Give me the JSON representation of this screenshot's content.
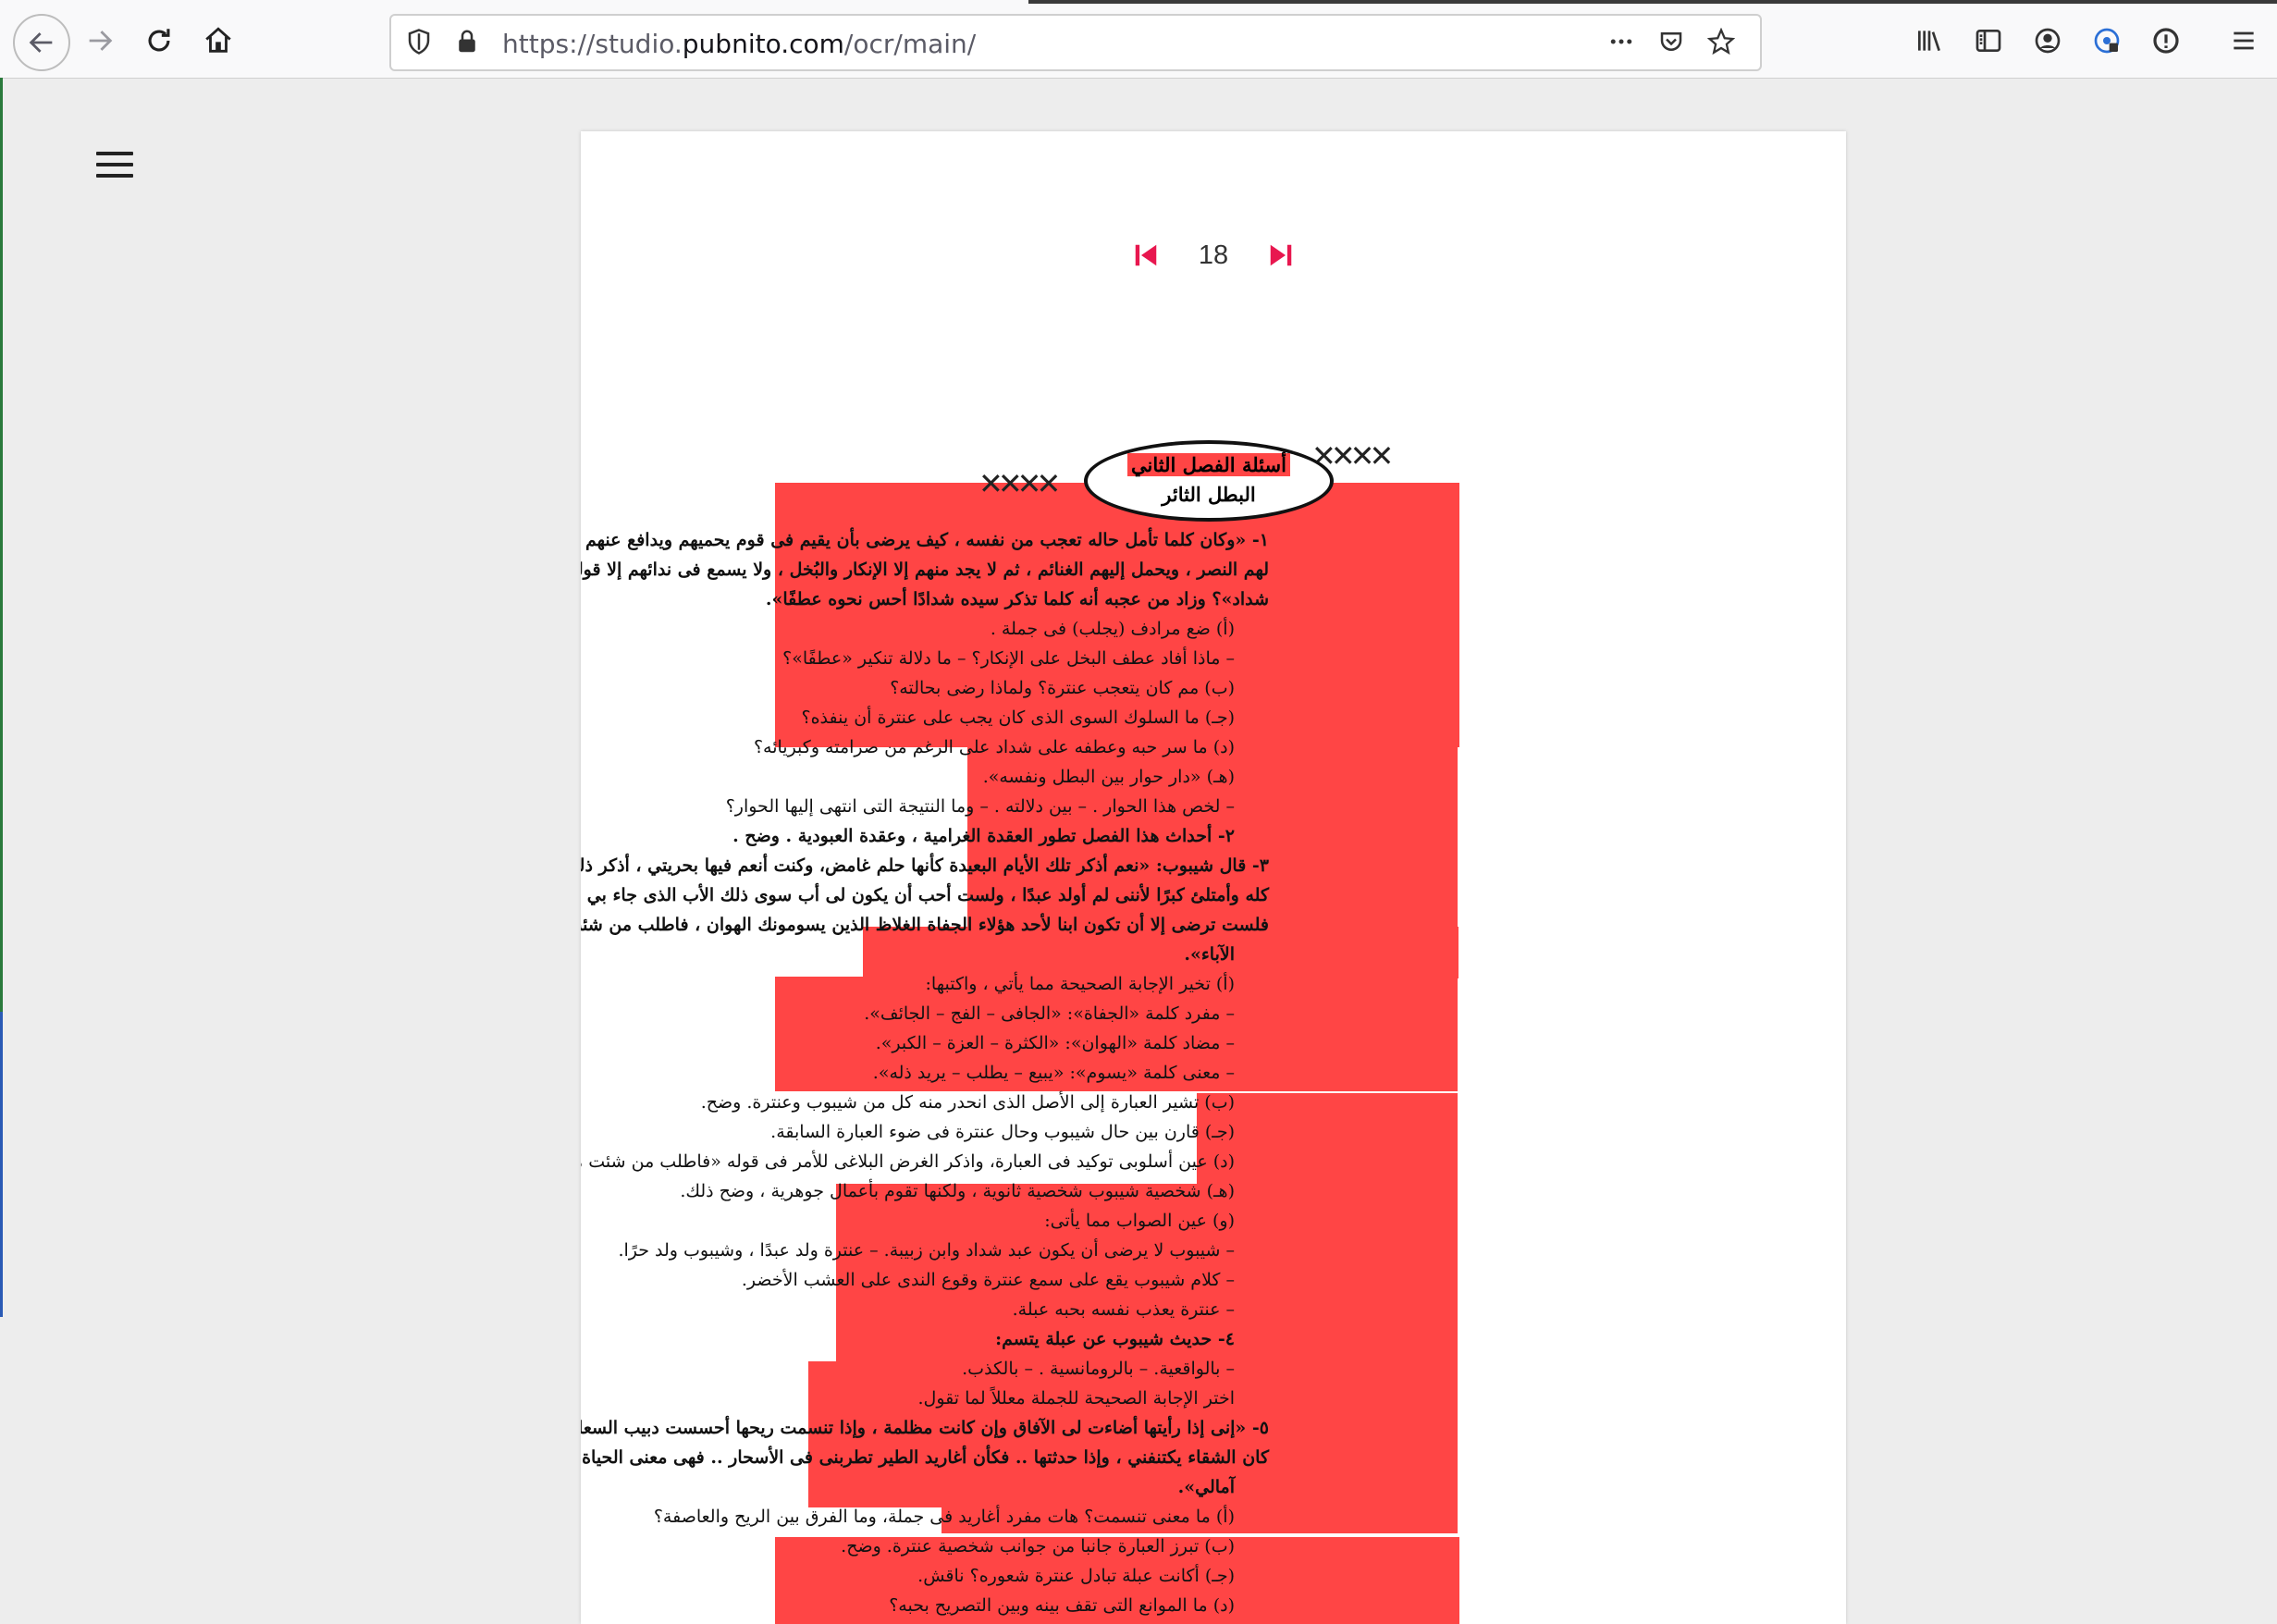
{
  "browser": {
    "url_prefix": "https://studio.",
    "url_domain": "pubnito.com",
    "url_path": "/ocr/main/",
    "icons": [
      "back-icon",
      "forward-icon",
      "reload-icon",
      "home-icon",
      "shield-icon",
      "lock-icon",
      "more-icon",
      "pocket-icon",
      "star-icon",
      "library-icon",
      "sidebar-icon",
      "account-icon",
      "extension-icon",
      "info-icon",
      "menu-icon"
    ]
  },
  "viewer": {
    "page_number": "18",
    "accent_color": "#e8174f",
    "highlight_color": "#ff4545"
  },
  "document": {
    "title_line1": "أسئلة الفصل الثاني",
    "title_line2": "البطل الثائر",
    "lines": [
      "١- «وكان كلما تأمل حاله تعجب من نفسه ، كيف يرضى بأن يقيم فى قوم يحميهم ويدافع عنهم ، ويجلب",
      "لهم النصر ، ويحمل إليهم الغنائم ، ثم لا يجد منهم إلا الإنكار والبُخل ، ولا يسمع فى ندائهم إلا قولهم «عبد",
      "شداد»؟ وزاد من عجبه أنه كلما تذكر سيده شدادًا أحس نحوه عطفًا».",
      "(أ) ضع مرادف (يجلب) فى جملة .",
      "– ماذا أفاد عطف البخل على الإنكار؟ – ما دلالة تنكير «عطفًا»؟",
      "(ب) مم كان يتعجب عنترة؟ ولماذا رضى بحالته؟",
      "(جـ) ما السلوك السوى الذى كان يجب على عنترة أن ينفذه؟",
      "(د) ما سر حبه وعطفه على شداد على الرغم من صرامته وكبريائه؟",
      "(هـ) «دار حوار بين البطل ونفسه».",
      "– لخص هذا الحوار . – بين دلالته . – وما النتيجة التى انتهى إليها الحوار؟",
      "٢- أحداث هذا الفصل تطور العقدة الغرامية ، وعقدة العبودية . وضح .",
      "٣- قال شيبوب: «نعم أذكر تلك الأيام البعيدة كأنها حلم غامض، وكنت أنعم فيها بحريتي ، أذكر ذلك",
      "كله وأمتلئ كبرًا لأننى لم أولد عبدًا ، ولست أحب أن يكون لى أب سوى ذلك الأب الذى جاء بي ، وأما انت",
      "فلست ترضى إلا أن تكون ابنا لأحد هؤلاء الجفاة الغلاظ الذين يسومونك الهوان ، فاطلب من شئت منهم من",
      "الآباء».",
      "(أ) تخير الإجابة الصحيحة مما يأتي ، واكتبها:",
      "– مفرد كلمة «الجفاة»: «الجافى – الفج – الجائف».",
      "– مضاد كلمة «الهوان»: «الكثرة – العزة – الكبر».",
      "– معنى كلمة «يسوم»: «يبيع – يطلب – يريد ذله».",
      "(ب) تشير العبارة إلى الأصل الذى انحدر منه كل من شيبوب وعنترة. وضح.",
      "(جـ) قارن بين حال شيبوب وحال عنترة فى ضوء العبارة السابقة.",
      "(د) عين أسلوبى توكيد فى العبارة، واذكر الغرض البلاغى للأمر فى قوله «فاطلب من شئت من الآباء».",
      "(هـ) شخصية شيبوب شخصية ثانوية ، ولكنها تقوم بأعمال جوهرية ، وضح ذلك.",
      "(و) عين الصواب مما يأتى:",
      "– شيبوب لا يرضى أن يكون عبد شداد وابن زبيبة. – عنترة ولد عبدًا ، وشيبوب ولد حرًا.",
      "– كلام شيبوب يقع على سمع عنترة وقوع الندى على العشب الأخضر.",
      "– عنترة يعذب نفسه بحبه عبلة.",
      "٤- حديث شيبوب عن عبلة يتسم:",
      "– بالواقعية. – بالرومانسية . – بالكذب.",
      "اختر الإجابة الصحيحة للجملة معللاً لما تقول.",
      "٥- «إنى إذا رأيتها أضاءت لى الآفاق وإن كانت مظلمة ، وإذا تنسمت ريحها أحسست دبيب السعادة وإن",
      "كان الشقاء يكتنفني ، وإذا حدثتها .. فكأن أغاريد الطير تطربنى فى الأسحار .. فهى معنى الحياة وغاية",
      "آمالي».",
      "(أ) ما معنى تنسمت؟ هات مفرد أغاريد فى جملة، وما الفرق بين الريح والعاصفة؟",
      "(ب) تبرز العبارة جانبا من جوانب شخصية عنترة. وضح.",
      "(جـ) أكانت عبلة تبادل عنترة شعوره؟ ناقش.",
      "(د) ما الموانع التى تقف بينه وبين التصريح بحبه؟"
    ]
  }
}
